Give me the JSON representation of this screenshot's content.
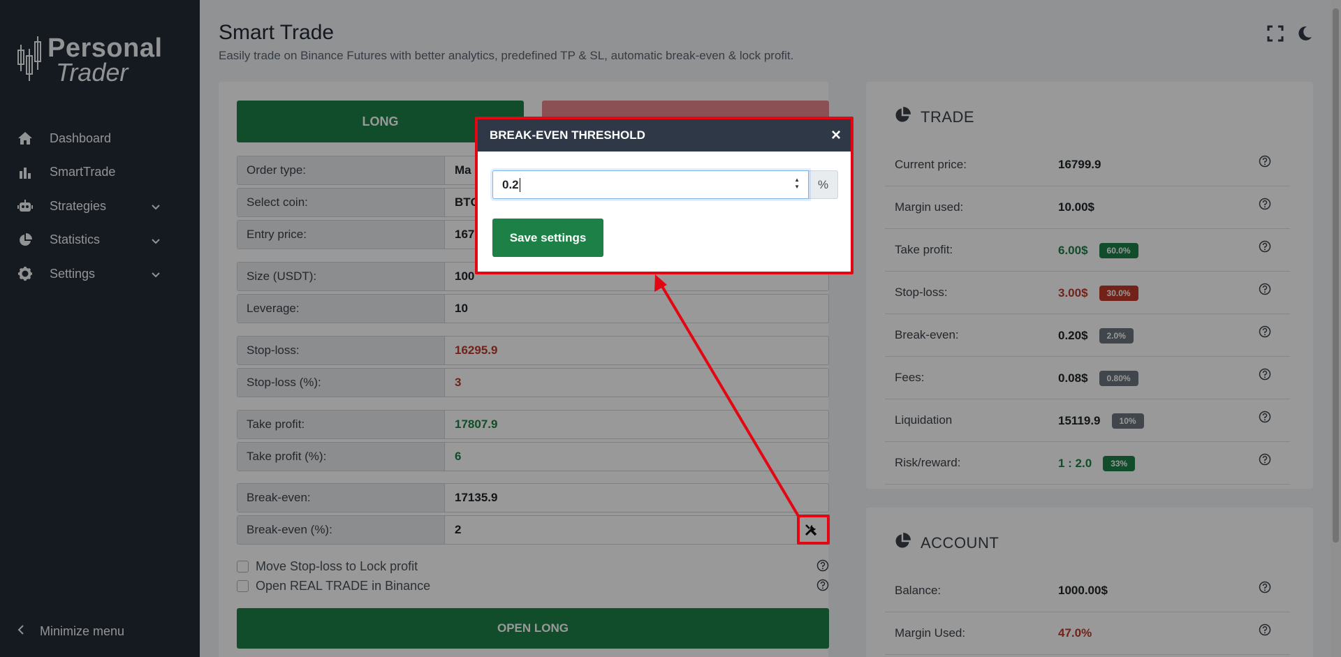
{
  "sidebar": {
    "logo_line1": "Personal",
    "logo_line2": "Trader",
    "items": [
      {
        "label": "Dashboard",
        "icon": "home-icon"
      },
      {
        "label": "SmartTrade",
        "icon": "bar-chart-icon"
      },
      {
        "label": "Strategies",
        "icon": "robot-icon",
        "has_submenu": true
      },
      {
        "label": "Statistics",
        "icon": "pie-chart-icon",
        "has_submenu": true
      },
      {
        "label": "Settings",
        "icon": "gear-icon",
        "has_submenu": true
      }
    ],
    "minimize_label": "Minimize menu"
  },
  "header": {
    "title": "Smart Trade",
    "subtitle": "Easily trade on Binance Futures with better analytics, predefined TP & SL, automatic break-even & lock profit."
  },
  "form": {
    "long_label": "LONG",
    "rows": {
      "order_type": {
        "label": "Order type:",
        "value": "Ma"
      },
      "select_coin": {
        "label": "Select coin:",
        "value": "BTC"
      },
      "entry_price": {
        "label": "Entry price:",
        "value": "167"
      },
      "size": {
        "label": "Size (USDT):",
        "value": "100"
      },
      "leverage": {
        "label": "Leverage:",
        "value": "10"
      },
      "stop_loss": {
        "label": "Stop-loss:",
        "value": "16295.9"
      },
      "stop_loss_pct": {
        "label": "Stop-loss (%):",
        "value": "3"
      },
      "take_profit": {
        "label": "Take profit:",
        "value": "17807.9"
      },
      "take_profit_pct": {
        "label": "Take profit (%):",
        "value": "6"
      },
      "break_even": {
        "label": "Break-even:",
        "value": "17135.9"
      },
      "break_even_pct": {
        "label": "Break-even (%):",
        "value": "2"
      }
    },
    "checks": {
      "lock_profit": "Move Stop-loss to Lock profit",
      "real_trade": "Open REAL TRADE in Binance"
    },
    "open_label": "OPEN LONG"
  },
  "trade": {
    "title": "TRADE",
    "stats": [
      {
        "label": "Current price:",
        "value": "16799.9",
        "color": "dark",
        "badge": ""
      },
      {
        "label": "Margin used:",
        "value": "10.00$",
        "color": "dark",
        "badge": ""
      },
      {
        "label": "Take profit:",
        "value": "6.00$",
        "color": "green",
        "badge": "60.0%",
        "badge_color": "green"
      },
      {
        "label": "Stop-loss:",
        "value": "3.00$",
        "color": "red",
        "badge": "30.0%",
        "badge_color": "red"
      },
      {
        "label": "Break-even:",
        "value": "0.20$",
        "color": "dark",
        "badge": "2.0%",
        "badge_color": "gray"
      },
      {
        "label": "Fees:",
        "value": "0.08$",
        "color": "dark",
        "badge": "0.80%",
        "badge_color": "gray"
      },
      {
        "label": "Liquidation",
        "value": "15119.9",
        "color": "dark",
        "badge": "10%",
        "badge_color": "gray"
      },
      {
        "label": "Risk/reward:",
        "value": "1 : 2.0",
        "color": "green",
        "badge": "33%",
        "badge_color": "green"
      }
    ]
  },
  "account": {
    "title": "ACCOUNT",
    "stats": [
      {
        "label": "Balance:",
        "value": "1000.00$",
        "color": "dark"
      },
      {
        "label": "Margin Used:",
        "value": "47.0%",
        "color": "red"
      }
    ]
  },
  "modal": {
    "title": "BREAK-EVEN THRESHOLD",
    "close": "×",
    "input_value": "0.2",
    "unit": "%",
    "save_label": "Save settings"
  },
  "colors": {
    "sidebar_bg": "#232a36",
    "accent_green": "#1d8147",
    "danger_red": "#c0392b",
    "highlight_red": "#e30613"
  }
}
